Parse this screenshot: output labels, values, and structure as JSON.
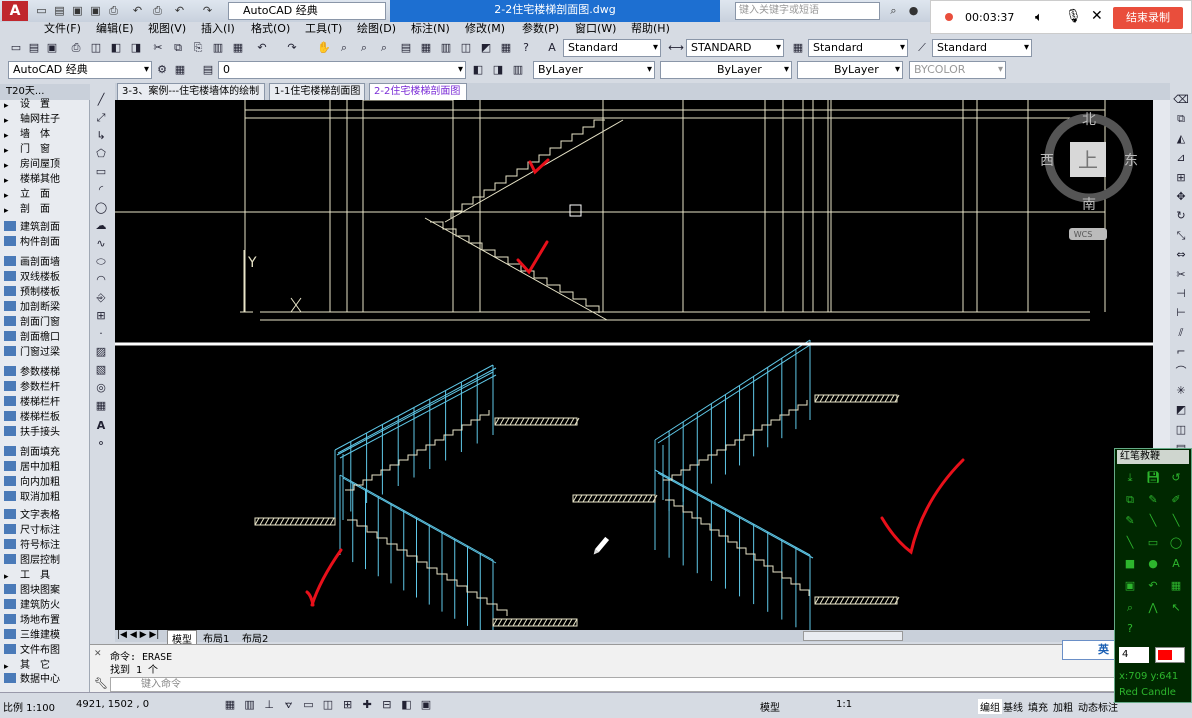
{
  "app": {
    "doc_title": "2-2住宅楼梯剖面图.dwg",
    "workspace": "AutoCAD 经典",
    "search_placeholder": "键入关键字或短语",
    "logo": "A"
  },
  "recorder": {
    "time": "00:03:37",
    "end_label": "结束录制"
  },
  "menu": [
    "文件(F)",
    "编辑(E)",
    "视图(V)",
    "插入(I)",
    "格式(O)",
    "工具(T)",
    "绘图(D)",
    "标注(N)",
    "修改(M)",
    "参数(P)",
    "窗口(W)",
    "帮助(H)"
  ],
  "toolbar": {
    "text_style": "Standard",
    "dim_style": "STANDARD",
    "table_style": "Standard",
    "mleader_style": "Standard",
    "workspace2": "AutoCAD 经典",
    "layer": "0",
    "color": "ByLayer",
    "linetype": "ByLayer",
    "lineweight": "ByLayer",
    "plotstyle": "BYCOLOR"
  },
  "doc_tabs": [
    "3-3、案例---住宅楼墙体的绘制",
    "1-1住宅楼梯剖面图",
    "2-2住宅楼梯剖面图"
  ],
  "t20": {
    "title": "T20天...",
    "items": [
      "设　置",
      "轴网柱子",
      "墙　体",
      "门　窗",
      "房间屋顶",
      "楼梯其他",
      "立　面",
      "剖　面",
      "建筑剖面",
      "构件剖面",
      "画剖面墙",
      "双线楼板",
      "预制楼板",
      "加剖断梁",
      "剖面门窗",
      "剖面檐口",
      "门窗过梁",
      "参数楼梯",
      "参数栏杆",
      "楼梯栏杆",
      "楼梯栏板",
      "扶手接头",
      "剖面填充",
      "居中加粗",
      "向内加粗",
      "取消加粗",
      "文字表格",
      "尺寸标注",
      "符号标注",
      "图层控制",
      "工　具",
      "图块图案",
      "建筑防火",
      "场地布置",
      "三维建模",
      "文件布图",
      "其　它",
      "数据中心"
    ]
  },
  "viewcube": {
    "north": "北",
    "south": "南",
    "east": "东",
    "west": "西",
    "top": "上",
    "wcs": "WCS"
  },
  "ucs": {
    "y": "Y"
  },
  "layout_tabs": [
    "模型",
    "布局1",
    "布局2"
  ],
  "command": {
    "line1": "命令:  ERASE",
    "line2": "找到 1 个",
    "prompt": "键入命令"
  },
  "status": {
    "scale": "比例 1:100",
    "coords": "4921, 1502 , 0",
    "model": "模型",
    "anno_scale": "1:1",
    "right_items": [
      "编组",
      "基线",
      "填充",
      "加粗",
      "动态标注"
    ]
  },
  "tool_panel": {
    "title": "红笔教鞭",
    "size": "4",
    "coords": "x:709  y:641",
    "label": "Red Candle",
    "pen_color": "#ff0000"
  },
  "ime": {
    "label": "英"
  },
  "colors": {
    "canvas": "#000000",
    "stairs": "#5fc8e8",
    "annotation": "#e8101a",
    "elevation": "#e8e4c8"
  }
}
